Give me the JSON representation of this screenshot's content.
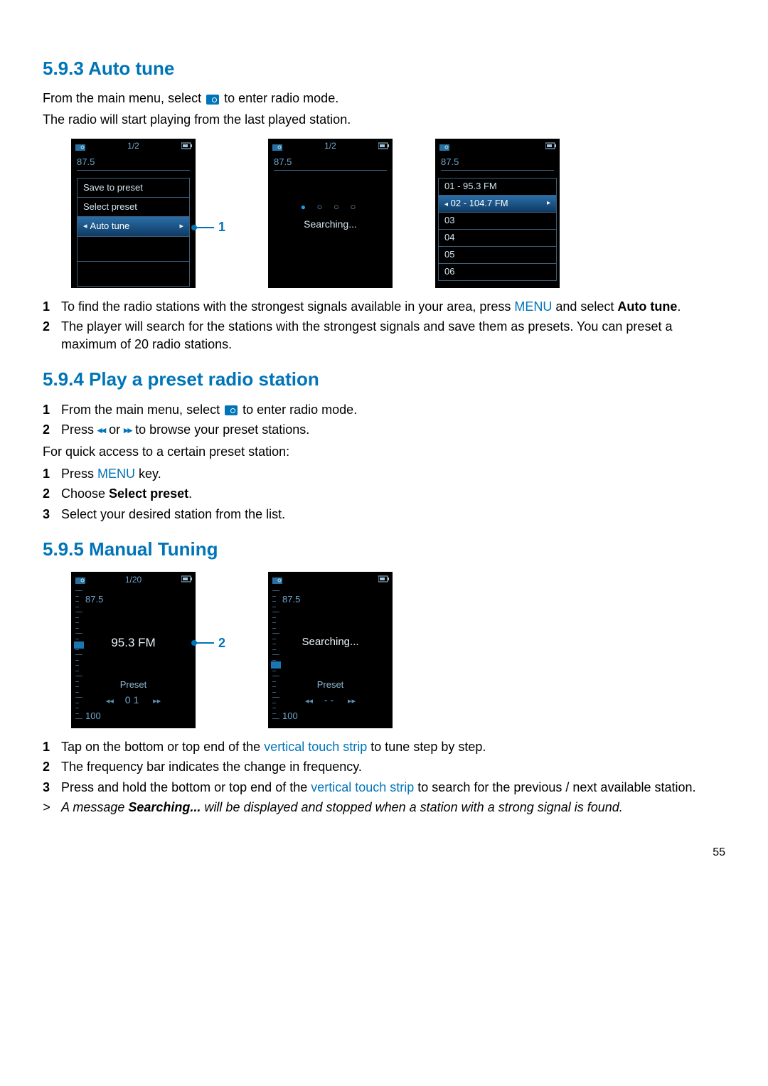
{
  "sec593": {
    "heading": "5.9.3 Auto tune",
    "intro1_a": "From the main menu, select ",
    "intro1_b": " to enter radio mode.",
    "intro2": "The radio will start playing from the last played station.",
    "screens": {
      "s1": {
        "page": "1/2",
        "freq": "87.5",
        "menu": [
          "Save to preset",
          "Select preset",
          "Auto tune"
        ],
        "callout": "1"
      },
      "s2": {
        "page": "1/2",
        "freq": "87.5",
        "searching": "Searching..."
      },
      "s3": {
        "freq": "87.5",
        "presets": [
          {
            "n": "01",
            "v": "95.3 FM",
            "sel": false
          },
          {
            "n": "02",
            "v": "104.7 FM",
            "sel": true
          },
          {
            "n": "03",
            "v": "",
            "sel": false
          },
          {
            "n": "04",
            "v": "",
            "sel": false
          },
          {
            "n": "05",
            "v": "",
            "sel": false
          },
          {
            "n": "06",
            "v": "",
            "sel": false
          }
        ]
      }
    },
    "steps": [
      {
        "n": "1",
        "a": "To find the radio stations with the strongest signals available in your area, press ",
        "menu": "MENU",
        "b": " and select ",
        "bold": "Auto tune",
        "c": "."
      },
      {
        "n": "2",
        "a": "The player will search for the stations with the strongest signals and save them as presets. You can preset a maximum of 20 radio stations."
      }
    ]
  },
  "sec594": {
    "heading": "5.9.4 Play a preset radio station",
    "steps1": [
      {
        "n": "1",
        "a": "From the main menu, select ",
        "b": " to enter radio mode."
      },
      {
        "n": "2",
        "a": "Press ",
        "b": " or ",
        "c": " to browse your preset stations."
      }
    ],
    "quick_intro": "For quick access to a certain preset station:",
    "steps2": [
      {
        "n": "1",
        "a": "Press ",
        "menu": "MENU",
        "b": " key."
      },
      {
        "n": "2",
        "a": "Choose ",
        "bold": "Select preset",
        "b": "."
      },
      {
        "n": "3",
        "a": "Select your desired station from the list."
      }
    ]
  },
  "sec595": {
    "heading": "5.9.5 Manual Tuning",
    "screens": {
      "s1": {
        "page": "1/20",
        "ftop": "87.5",
        "fbot": "100",
        "center": "95.3 FM",
        "preset": "Preset",
        "pnum": "01",
        "callout": "2"
      },
      "s2": {
        "ftop": "87.5",
        "fbot": "100",
        "center": "Searching...",
        "preset": "Preset",
        "pnum": "--"
      }
    },
    "steps": [
      {
        "n": "1",
        "a": "Tap on the bottom or top end of the ",
        "blue": "vertical touch strip",
        "b": " to tune step by step."
      },
      {
        "n": "2",
        "a": "The frequency bar indicates the change in frequency."
      },
      {
        "n": "3",
        "a": "Press and hold the bottom or top end of the ",
        "blue": "vertical touch strip",
        "b": " to search for the previous / next available station."
      }
    ],
    "result_a": "A message ",
    "result_bold": "Searching...",
    "result_b": " will be displayed and stopped when a station with a strong signal is found."
  },
  "page_number": "55",
  "icons": {
    "prev": "◂◂",
    "next": "▸▸"
  }
}
